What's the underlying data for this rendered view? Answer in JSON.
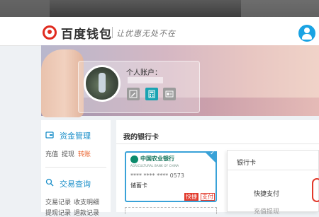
{
  "header": {
    "logo_text": "百度钱包",
    "slogan": "让优惠无处不在"
  },
  "profile": {
    "account_label": "个人账户："
  },
  "sidebar": {
    "asset_title": "资金管理",
    "asset_links": [
      "充值",
      "提现",
      "转账"
    ],
    "trade_title": "交易查询",
    "trade_links": [
      "交易记录",
      "收支明细"
    ],
    "trade_links_row2": [
      "提现记录",
      "退款记录"
    ]
  },
  "main": {
    "title": "我的银行卡",
    "card": {
      "bank_name": "中国农业银行",
      "bank_name_en": "AGRICULTURAL BANK OF CHINA",
      "number": "**** **** **** 0573",
      "type": "储蓄卡",
      "tag_quick": "快捷",
      "tag_pay": "支付"
    }
  },
  "panel": {
    "title": "银行卡",
    "option1": "快捷支付",
    "option2": "充值提现"
  },
  "colors": {
    "accent": "#1aa3e3",
    "brand_red": "#e02b1f",
    "link_blue": "#1b8fc9",
    "hot": "#e9612b"
  }
}
